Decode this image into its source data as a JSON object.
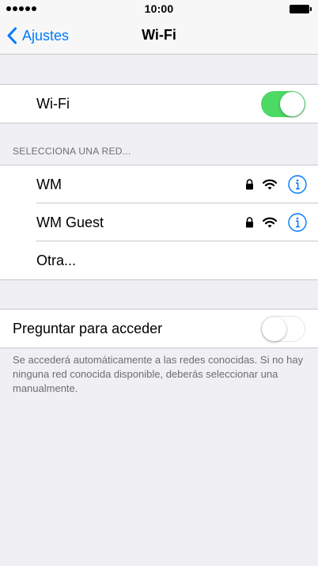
{
  "status_bar": {
    "time": "10:00",
    "signal_dots": 5
  },
  "nav": {
    "back_label": "Ajustes",
    "title": "Wi-Fi"
  },
  "wifi_toggle": {
    "label": "Wi-Fi",
    "on": true
  },
  "networks_header": "SELECCIONA UNA RED...",
  "networks": [
    {
      "name": "WM",
      "secured": true,
      "icons": [
        "lock-icon",
        "wifi-icon",
        "info-icon"
      ]
    },
    {
      "name": "WM Guest",
      "secured": true,
      "icons": [
        "lock-icon",
        "wifi-icon",
        "info-icon"
      ]
    },
    {
      "name": "Otra..."
    }
  ],
  "ask_to_join": {
    "label": "Preguntar para acceder",
    "on": false,
    "footer": "Se accederá automáticamente a las redes conocidas. Si no hay ninguna red conocida disponible, deberás seleccionar una manualmente."
  },
  "colors": {
    "accent": "#007aff",
    "toggle_on": "#4cd964",
    "background": "#efeff4",
    "separator": "#c8c7cc"
  }
}
